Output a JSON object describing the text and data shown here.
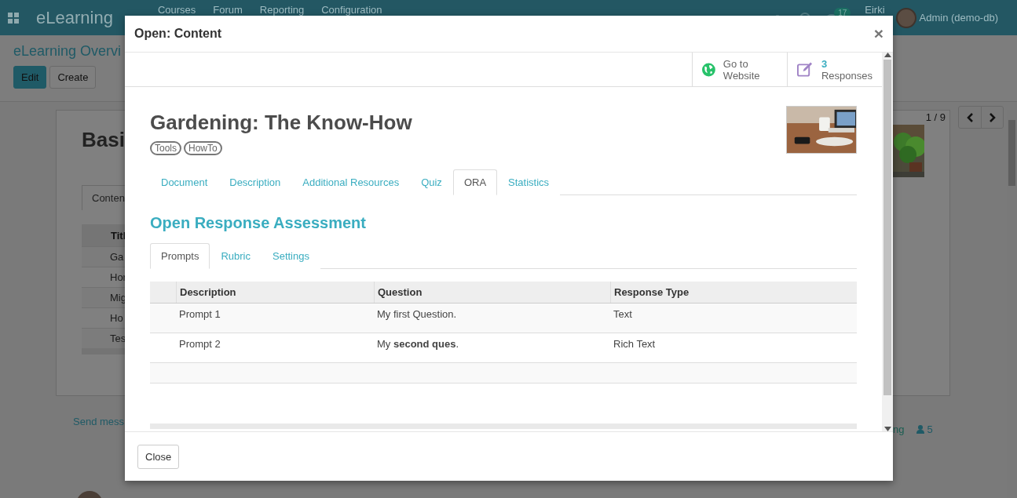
{
  "navbar": {
    "app_name": "eLearning",
    "menu": [
      "Courses",
      "Forum",
      "Reporting",
      "Configuration"
    ],
    "message_count": "17",
    "company": "Eirki",
    "user": "Admin (demo-db)"
  },
  "control_panel": {
    "breadcrumb": "eLearning Overvi",
    "buttons": [
      "Edit",
      "Create"
    ],
    "pager": "1 / 9"
  },
  "record": {
    "title": "Basi",
    "tab": "Conten",
    "column": "Titl",
    "rows": [
      "Ga",
      "Hor",
      "Mig",
      "Ho",
      "Tes"
    ]
  },
  "chatter": {
    "send_message": "Send mess",
    "log_link": "ng",
    "followers": "5"
  },
  "dialog": {
    "title": "Open: Content",
    "close_glyph": "×",
    "stat_buttons": [
      {
        "kind": "website",
        "label": "Go to Website"
      },
      {
        "kind": "responses",
        "value": "3",
        "label": "Responses"
      }
    ],
    "name": "Gardening: The Know-How",
    "tags": [
      "Tools",
      "HowTo"
    ],
    "tabs": [
      {
        "label": "Document",
        "selected": false
      },
      {
        "label": "Description",
        "selected": false
      },
      {
        "label": "Additional Resources",
        "selected": false
      },
      {
        "label": "Quiz",
        "selected": false
      },
      {
        "label": "ORA",
        "selected": true
      },
      {
        "label": "Statistics",
        "selected": false
      }
    ],
    "section_title": "Open Response Assessment",
    "subtabs": [
      {
        "label": "Prompts",
        "selected": true
      },
      {
        "label": "Rubric",
        "selected": false
      },
      {
        "label": "Settings",
        "selected": false
      }
    ],
    "table": {
      "columns": [
        "Description",
        "Question",
        "Response Type"
      ],
      "rows": [
        [
          "Prompt 1",
          "My first Question.",
          "Text"
        ],
        [
          "Prompt 2",
          "My **second ques**.",
          "Rich Text"
        ]
      ]
    },
    "buttons": [
      "Close"
    ]
  }
}
